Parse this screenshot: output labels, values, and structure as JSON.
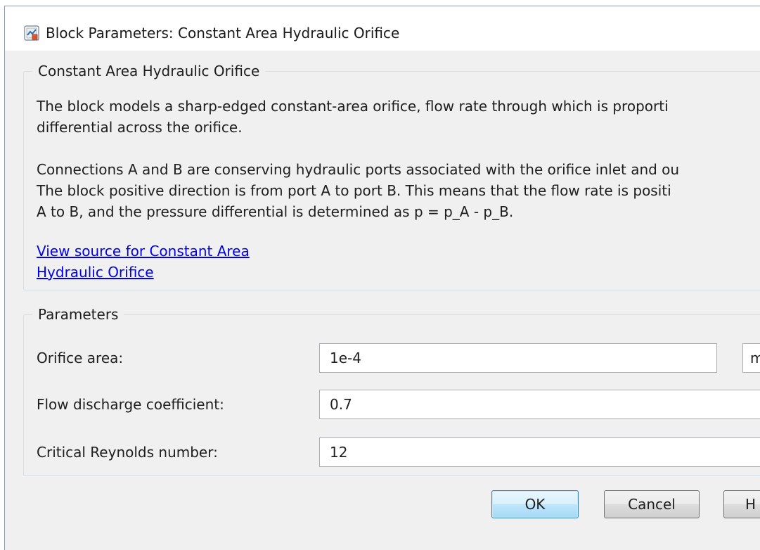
{
  "window": {
    "title": "Block Parameters: Constant Area Hydraulic Orifice",
    "icon": "simulink-block-icon"
  },
  "description": {
    "legend": "Constant Area Hydraulic Orifice",
    "paragraph1_line1": "The block models a sharp-edged constant-area orifice, flow rate through which is proporti",
    "paragraph1_line2": "differential across the orifice.",
    "paragraph2_line1": "Connections A and B are conserving hydraulic ports associated with the orifice inlet and ou",
    "paragraph2_line2": "The block positive direction is from port A to port B. This means that the flow rate is positi",
    "paragraph2_line3": "A to B, and the pressure differential is determined as p = p_A - p_B.",
    "link_line1": "View source for Constant Area",
    "link_line2": "Hydraulic Orifice"
  },
  "parameters": {
    "legend": "Parameters",
    "fields": [
      {
        "label": "Orifice area:",
        "value": "1e-4",
        "unit": "m"
      },
      {
        "label": "Flow discharge coefficient:",
        "value": "0.7"
      },
      {
        "label": "Critical Reynolds number:",
        "value": "12"
      }
    ]
  },
  "buttons": {
    "ok": "OK",
    "cancel": "Cancel",
    "help": "H"
  },
  "colors": {
    "window_background": "#f0f0f0",
    "titlebar_background": "#ffffff",
    "link": "#0000ee",
    "ok_button_border": "#3c7fb1"
  }
}
